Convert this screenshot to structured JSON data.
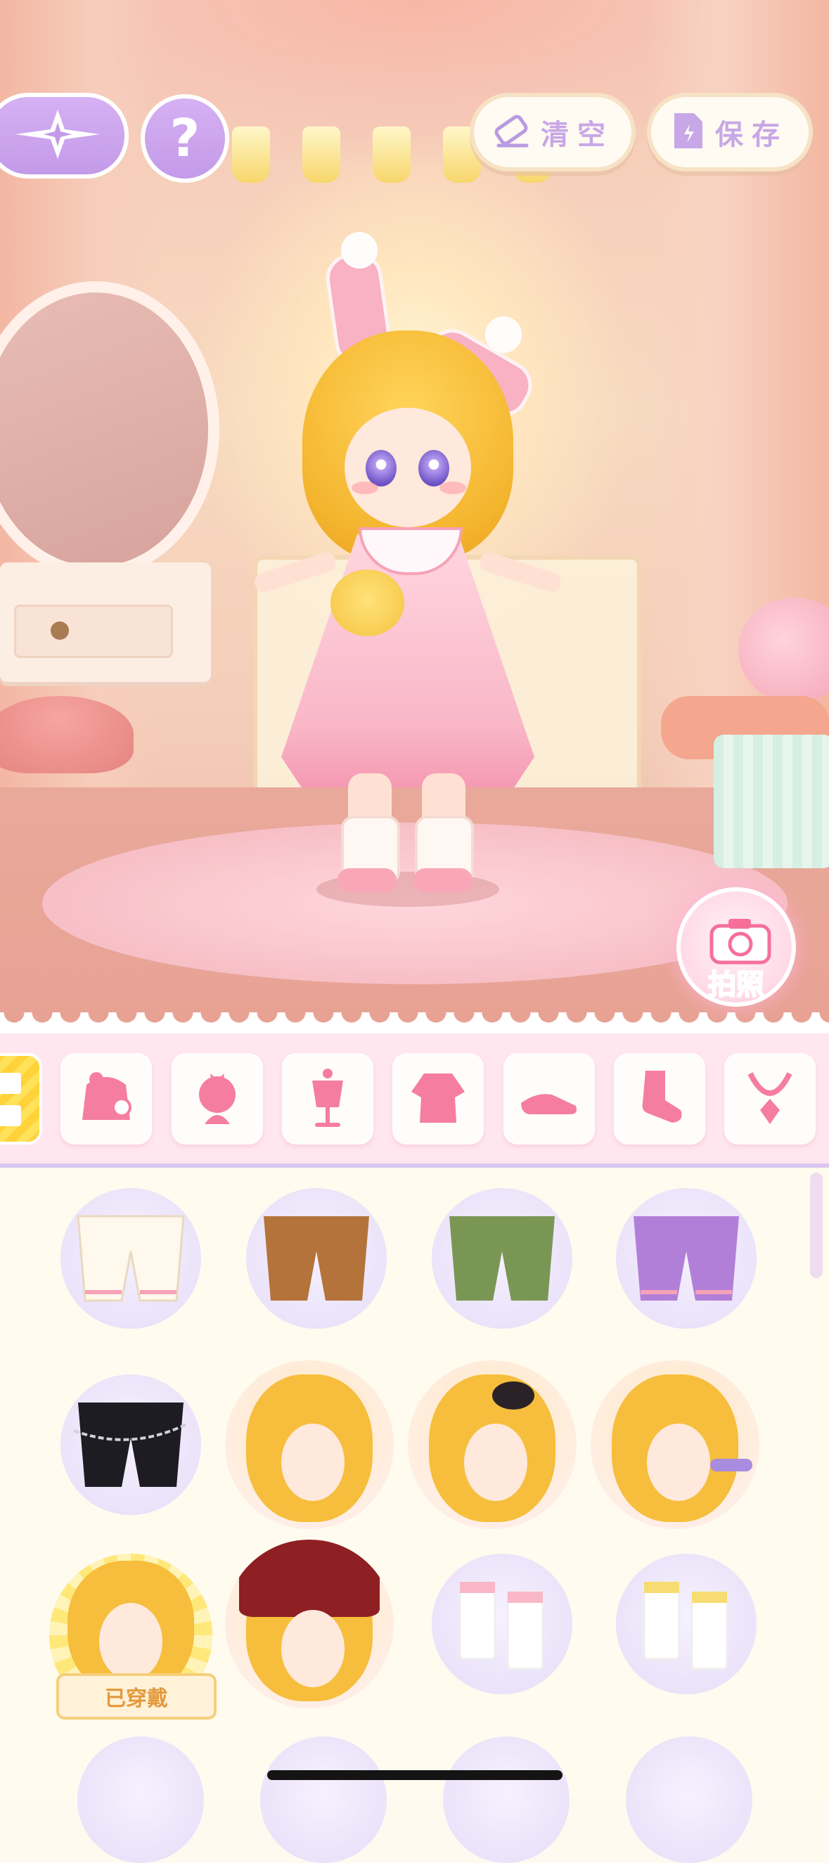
{
  "header": {
    "back_icon": "compass-star-icon",
    "help_label": "?",
    "clear_label": "清空",
    "save_label": "保存"
  },
  "photo": {
    "label": "拍照"
  },
  "categories": [
    {
      "icon": "stripes-active-tab",
      "active": true
    },
    {
      "icon": "outfit-set-icon"
    },
    {
      "icon": "head-bow-icon"
    },
    {
      "icon": "mannequin-icon"
    },
    {
      "icon": "dress-icon"
    },
    {
      "icon": "shoe-icon"
    },
    {
      "icon": "sock-icon"
    },
    {
      "icon": "necklace-icon"
    }
  ],
  "items": {
    "worn_label": "已穿戴",
    "rows": [
      [
        "shorts-cream",
        "shorts-brown",
        "shorts-green",
        "shorts-purple"
      ],
      [
        "shorts-black-chain",
        "hair-braid-blue-clip",
        "hair-black-bow",
        "hair-purple-braid"
      ],
      [
        "hair-ahoge-worn",
        "hair-red-kerchief",
        "socks-pink-cuff",
        "socks-yellow-cuff"
      ]
    ]
  },
  "colors": {
    "accent_purple": "#c8a7e6",
    "photo_pink": "#f56f9a",
    "category_bg": "#ffe6ef",
    "grid_bg": "#fffbef"
  }
}
